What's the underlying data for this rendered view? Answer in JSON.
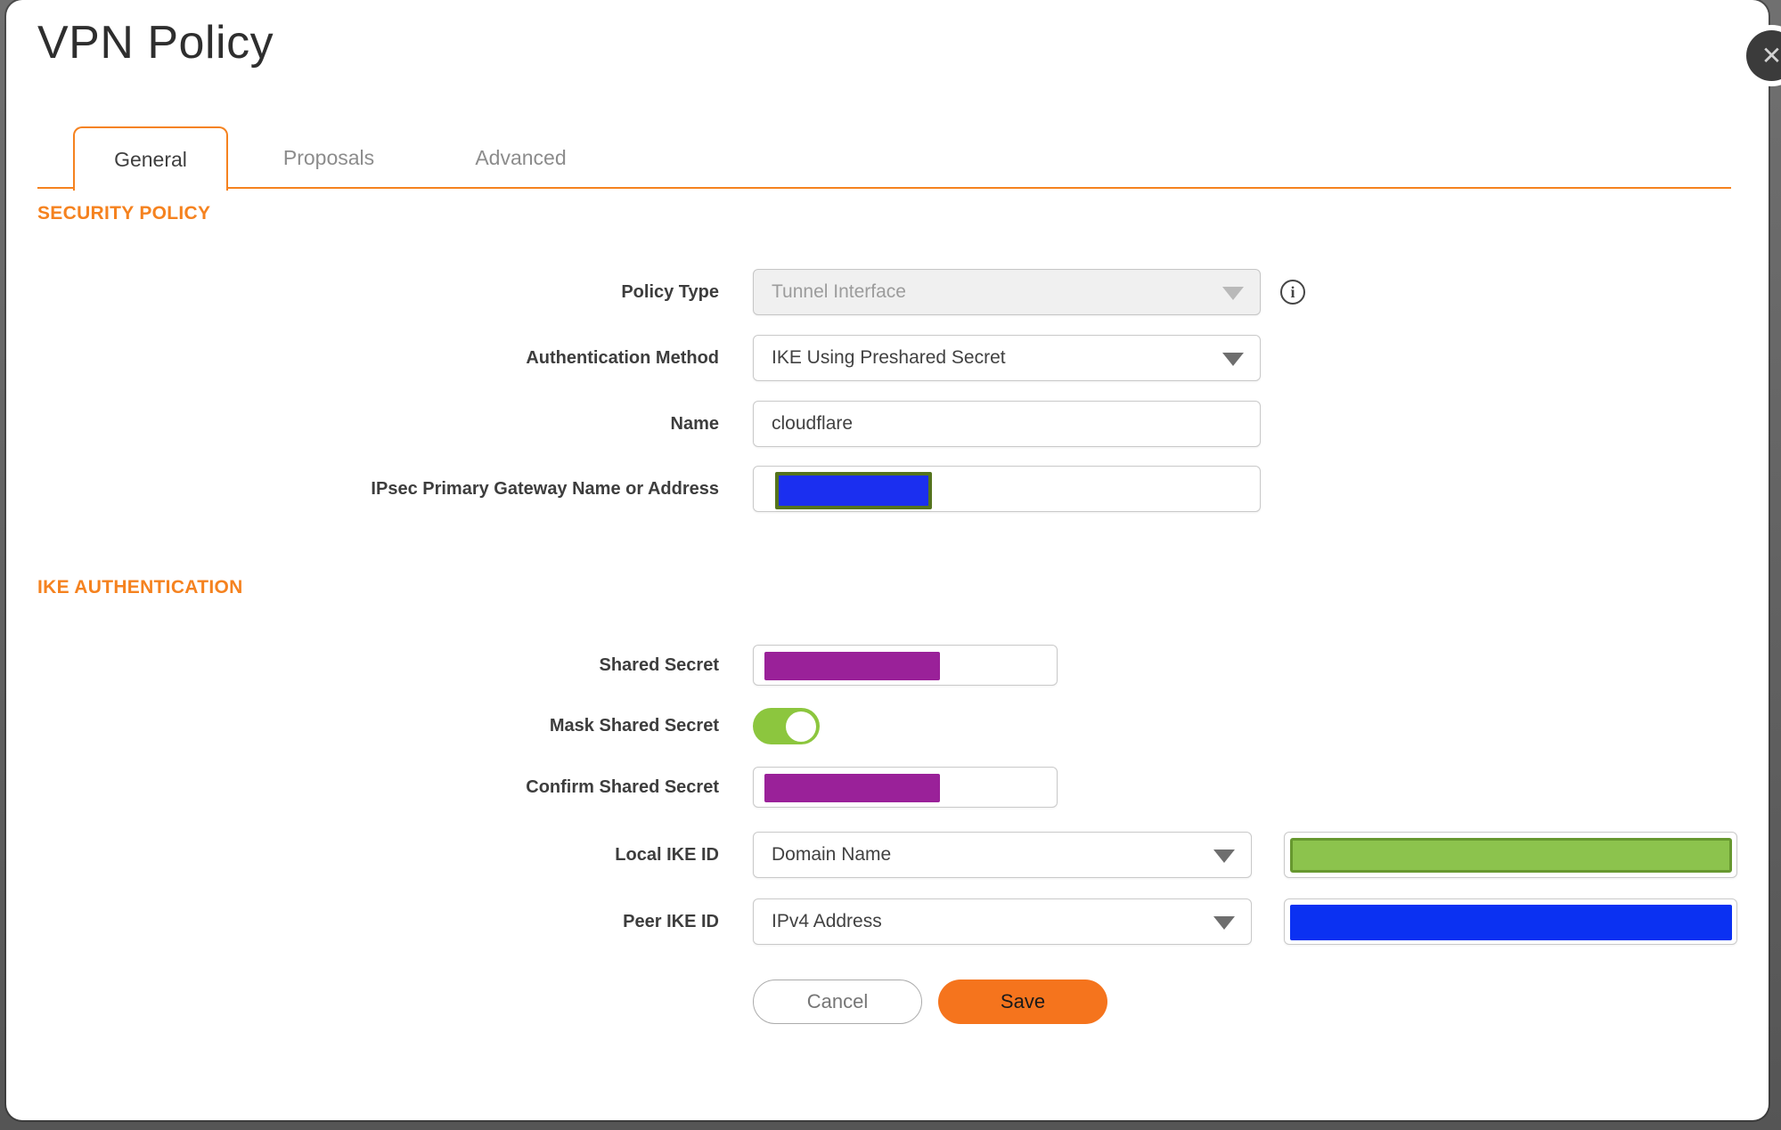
{
  "window": {
    "title": "VPN Policy"
  },
  "tabs": [
    {
      "label": "General",
      "active": true
    },
    {
      "label": "Proposals",
      "active": false
    },
    {
      "label": "Advanced",
      "active": false
    }
  ],
  "sections": {
    "security_policy": "SECURITY POLICY",
    "ike_authentication": "IKE AUTHENTICATION"
  },
  "form": {
    "policy_type": {
      "label": "Policy Type",
      "value": "Tunnel Interface",
      "disabled": true
    },
    "auth_method": {
      "label": "Authentication Method",
      "value": "IKE Using Preshared Secret"
    },
    "name": {
      "label": "Name",
      "value": "cloudflare"
    },
    "gateway": {
      "label": "IPsec Primary Gateway Name or Address",
      "value_redacted": true
    },
    "shared_secret": {
      "label": "Shared Secret",
      "value_redacted": true
    },
    "mask_shared_secret": {
      "label": "Mask Shared Secret",
      "enabled": true
    },
    "confirm_shared_secret": {
      "label": "Confirm Shared Secret",
      "value_redacted": true
    },
    "local_ike_id": {
      "label": "Local IKE ID",
      "value": "Domain Name",
      "extra_value_redacted": true
    },
    "peer_ike_id": {
      "label": "Peer IKE ID",
      "value": "IPv4 Address",
      "extra_value_redacted": true
    }
  },
  "buttons": {
    "cancel": "Cancel",
    "save": "Save"
  },
  "icons": {
    "close": "close-icon",
    "info": "info-icon",
    "dropdown": "chevron-down-icon"
  },
  "glyphs": {
    "close": "✕",
    "info": "i"
  },
  "colors": {
    "accent_orange": "#f5821f",
    "save_orange": "#f5741d",
    "toggle_green": "#8cc63e",
    "redact_purple": "#9a2199",
    "redact_blue": "#0b31f2",
    "redact_gateway_blue": "#1b2ff0",
    "redact_olive_border": "#55741d",
    "redact_green_fill": "#8cc34d",
    "redact_green_border": "#67982f",
    "backdrop_gray": "#646464"
  }
}
